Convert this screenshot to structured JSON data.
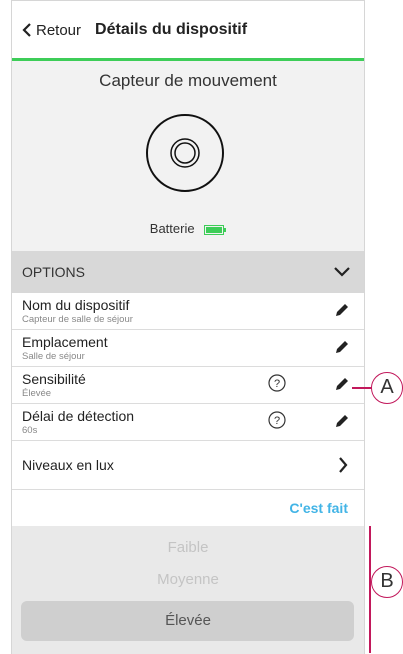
{
  "header": {
    "back_label": "Retour",
    "title": "Détails du dispositif"
  },
  "device": {
    "name": "Capteur de mouvement",
    "battery_label": "Batterie"
  },
  "options": {
    "title": "OPTIONS",
    "rows": [
      {
        "label": "Nom du dispositif",
        "value": "Capteur de salle de séjour"
      },
      {
        "label": "Emplacement",
        "value": "Salle de séjour"
      },
      {
        "label": "Sensibilité",
        "value": "Élevée"
      },
      {
        "label": "Délai de détection",
        "value": "60s"
      },
      {
        "label": "Niveaux en lux"
      }
    ],
    "done_label": "C'est fait"
  },
  "picker": {
    "options": [
      "Faible",
      "Moyenne",
      "Élevée"
    ],
    "selected": "Élevée"
  },
  "callouts": {
    "a": "A",
    "b": "B"
  },
  "colors": {
    "accent_green": "#3dcd58",
    "link_blue": "#42b4e6",
    "callout": "#c2185b"
  },
  "icons": [
    "chevron-left-icon",
    "motion-sensor-icon",
    "battery-icon",
    "chevron-down-icon",
    "pencil-icon",
    "help-icon",
    "chevron-right-icon"
  ]
}
